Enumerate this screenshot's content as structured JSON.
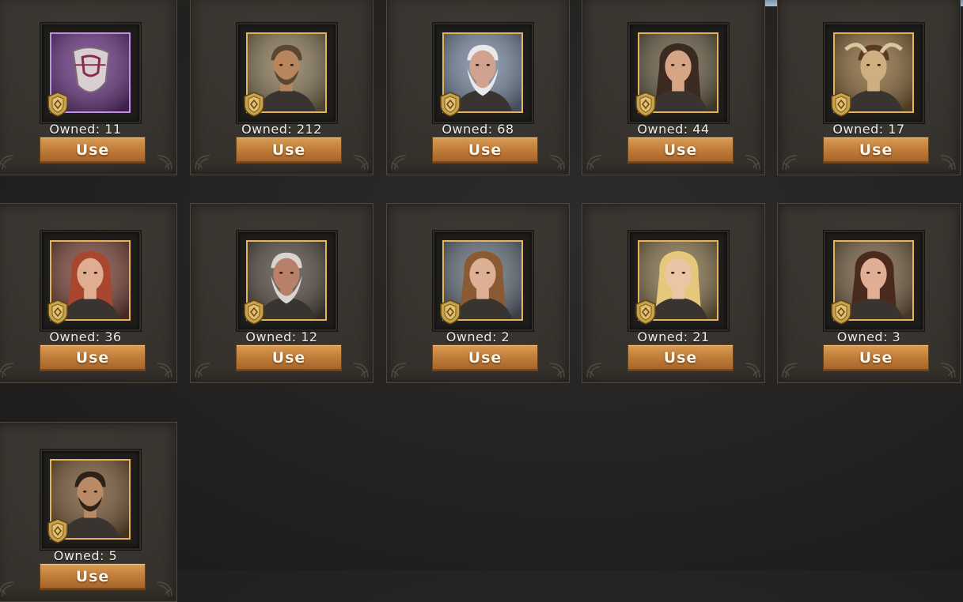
{
  "tabs": [
    {
      "label": ""
    },
    {
      "label": ""
    },
    {
      "label": "",
      "active": true
    }
  ],
  "use_label": "Use",
  "items": [
    {
      "owned": "Owned: 11",
      "portrait": "purple-shield-mask",
      "rarity": "epic"
    },
    {
      "owned": "Owned: 212",
      "portrait": "bearded-man-portrait",
      "rarity": "legendary"
    },
    {
      "owned": "Owned: 68",
      "portrait": "old-white-bearded-man-portrait",
      "rarity": "legendary"
    },
    {
      "owned": "Owned: 44",
      "portrait": "dark-haired-woman-portrait",
      "rarity": "legendary"
    },
    {
      "owned": "Owned: 17",
      "portrait": "horned-beast-rider-portrait",
      "rarity": "legendary"
    },
    {
      "owned": "Owned: 36",
      "portrait": "red-haired-woman-portrait",
      "rarity": "legendary"
    },
    {
      "owned": "Owned: 12",
      "portrait": "armored-bearded-warrior-portrait",
      "rarity": "legendary"
    },
    {
      "owned": "Owned: 2",
      "portrait": "brown-haired-woman-portrait",
      "rarity": "legendary"
    },
    {
      "owned": "Owned: 21",
      "portrait": "blonde-woman-portrait",
      "rarity": "legendary"
    },
    {
      "owned": "Owned: 3",
      "portrait": "brunette-woman-portrait",
      "rarity": "legendary"
    },
    {
      "owned": "Owned: 5",
      "portrait": "scarred-man-portrait",
      "rarity": "legendary"
    }
  ],
  "colors": {
    "frame_gold": "#e3b45a",
    "frame_epic": "#c290e6",
    "button": "#c27e3a",
    "active_tab": "#a6bfd2"
  }
}
